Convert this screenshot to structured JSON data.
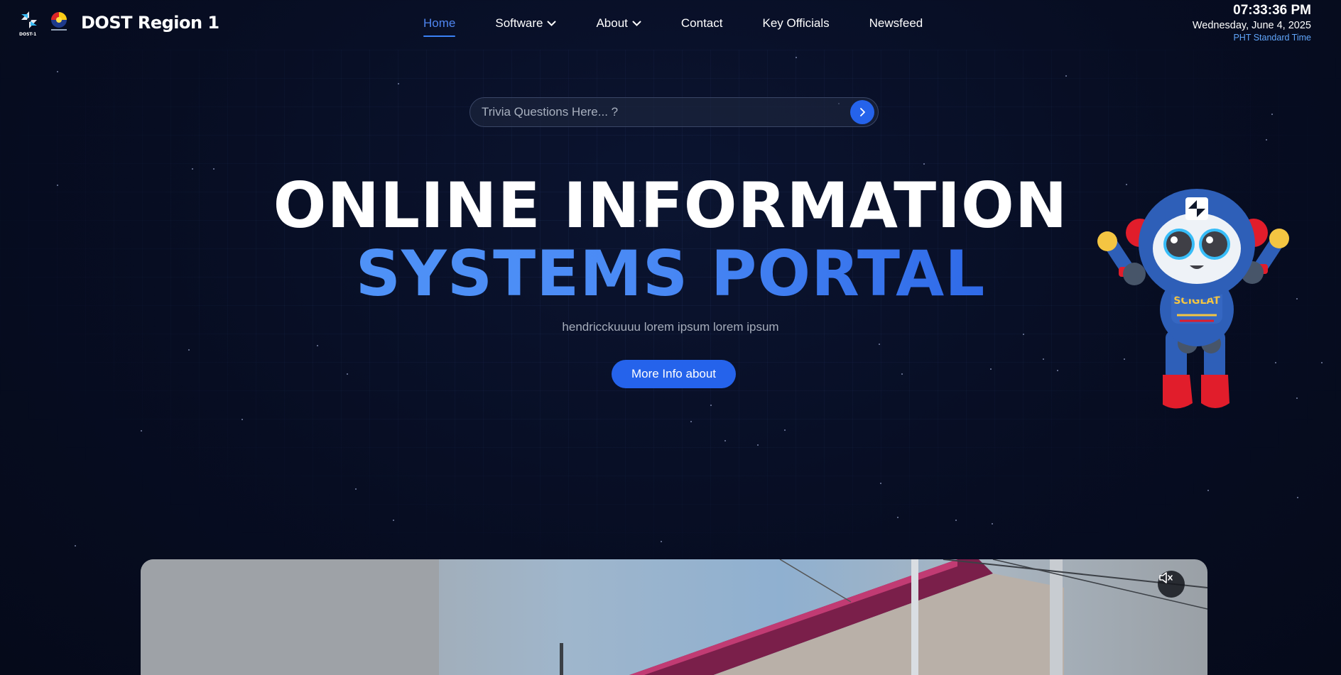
{
  "brand": {
    "title": "DOST Region 1",
    "logo_caption": "DOST-1"
  },
  "nav": {
    "items": [
      {
        "label": "Home",
        "active": true,
        "dropdown": false
      },
      {
        "label": "Software",
        "active": false,
        "dropdown": true
      },
      {
        "label": "About",
        "active": false,
        "dropdown": true
      },
      {
        "label": "Contact",
        "active": false,
        "dropdown": false
      },
      {
        "label": "Key Officials",
        "active": false,
        "dropdown": false
      },
      {
        "label": "Newsfeed",
        "active": false,
        "dropdown": false
      }
    ]
  },
  "clock": {
    "time": "07:33:36 PM",
    "date": "Wednesday, June 4, 2025",
    "timezone": "PHT Standard Time"
  },
  "search": {
    "placeholder": "Trivia Questions Here... ?",
    "submit_icon": "chevron-right-icon"
  },
  "hero": {
    "line1": "ONLINE INFORMATION",
    "line2": "SYSTEMS PORTAL",
    "subtitle": "hendricckuuuu lorem ipsum lorem ipsum",
    "cta_label": "More Info about"
  },
  "mascot": {
    "shirt_text": "SCIGLAT"
  },
  "video": {
    "mute_icon": "volume-mute-icon"
  },
  "colors": {
    "accent": "#2563eb",
    "accent_light": "#4f86f0",
    "background": "#070d22",
    "timezone_text": "#60a5fa"
  }
}
